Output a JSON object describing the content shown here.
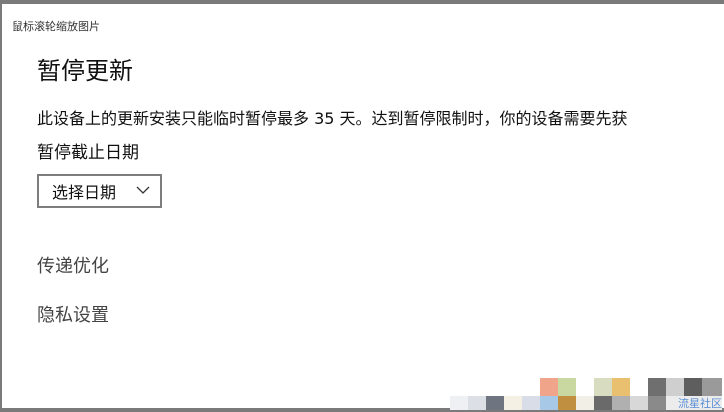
{
  "window": {
    "caption": "鼠标滚轮缩放图片"
  },
  "main": {
    "title": "暂停更新",
    "description": "此设备上的更新安装只能临时暂停最多 35 天。达到暂停限制时，你的设备需要先获",
    "pause_until_label": "暂停截止日期",
    "date_select": {
      "value": "选择日期",
      "icon": "chevron-down-icon"
    }
  },
  "links": {
    "delivery_optimization": "传递优化",
    "privacy_settings": "隐私设置"
  },
  "watermark": {
    "text": "流星社区"
  },
  "colors": {
    "background": "#ffffff",
    "frame": "#7a7a7a",
    "border": "#7d7d7d",
    "link_text": "#444444",
    "watermark": "#5b8fd6"
  }
}
